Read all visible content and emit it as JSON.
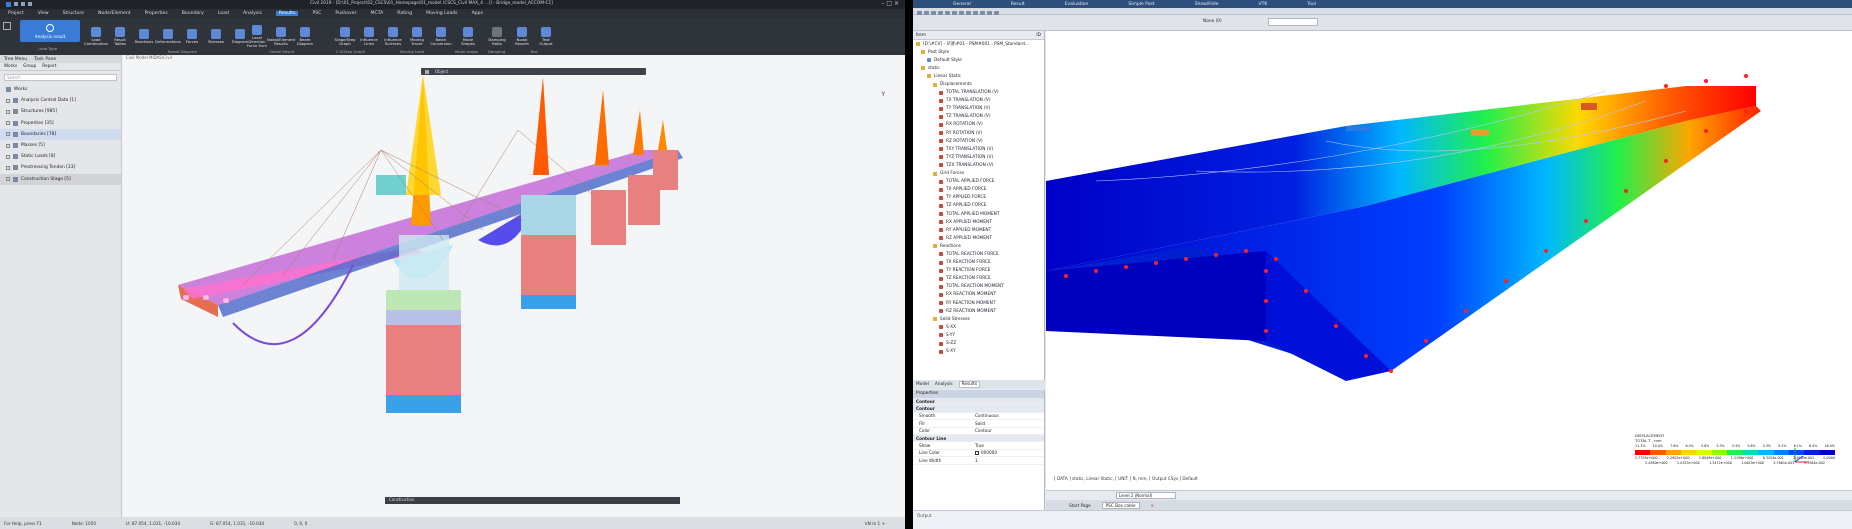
{
  "left": {
    "title": "Civil 2019 - [D:\\01_Project\\02_CSCS\\01_Homepage\\01_model (CSCS_Civil MAX_4 …)] - Bridge_model_ACCOM-C1]",
    "menu": [
      "Project",
      "View",
      "Structure",
      "Node/Element",
      "Properties",
      "Boundary",
      "Load",
      "Analysis",
      "Results",
      "PSC",
      "Pushover",
      "MCTA",
      "Rating",
      "Moving Loads",
      "Apps"
    ],
    "active_menu": "Results",
    "ribbon": {
      "analysis_result": "Analysis result",
      "load_type": "Load Type",
      "groups": [
        {
          "label": "Result Diagram",
          "buttons": [
            "Load Combination",
            "Result Tables",
            "Reactions",
            "Deformations",
            "Forces",
            "Stresses",
            "Diagram"
          ]
        },
        {
          "label": "Detail Result",
          "buttons": [
            "Local Direction Force Sum",
            "Nodal/Element Results",
            "Beam Diagram"
          ]
        },
        {
          "label": "Moving Load",
          "buttons": [
            "Stage/Step Graph",
            "Influence Lines",
            "Influence Surfaces",
            "Moving Tracer",
            "Batch Conversion"
          ]
        },
        {
          "label": "Mode shape",
          "buttons": [
            "Mode Shapes"
          ]
        },
        {
          "label": "Damping",
          "buttons": [
            "Damping Ratio"
          ]
        },
        {
          "label": "Text",
          "buttons": [
            "Nodal Results",
            "Text Output"
          ]
        }
      ],
      "c_sub": "C.S/Step Graph"
    },
    "sidebar": {
      "tabs": [
        "Tree Menu",
        "Task Pane"
      ],
      "subtabs": [
        "Works",
        "Group",
        "Report"
      ],
      "search_placeholder": "Search",
      "items": [
        {
          "label": "Works"
        },
        {
          "label": "Analysis Control Data [1]"
        },
        {
          "label": "Structures [985]"
        },
        {
          "label": "Properties [35]"
        },
        {
          "label": "Boundaries [78]"
        },
        {
          "label": "Masses [5]"
        },
        {
          "label": "Static Loads [8]"
        },
        {
          "label": "Prestressing Tendon [23]"
        },
        {
          "label": "Construction Stage [5]"
        }
      ]
    },
    "viewport_label": "Civil Model  MIDAS/Civil",
    "vp_toolbar": "Object",
    "timeline": "Construction",
    "axis_y": "Y",
    "status": [
      "For Help, press F1",
      "Node: 1050",
      "U: 87.054, 1.031, -10.034",
      "G: 87.054, 1.031, -10.034",
      "0, 0, 0"
    ],
    "status_right": "kN  m  1  +"
  },
  "right": {
    "tabs": [
      "General",
      "Result",
      "Evaluation",
      "Simple Post",
      "Show/Hide",
      "VTK",
      "Tool"
    ],
    "tree_header": "Item",
    "tree_header_right": "ID",
    "tree": [
      "[D:\\#CV] - 모델\\#01 - PSM#001 : PSM_Standard…",
      "Post Style",
      "Default Style",
      "static",
      "Linear Static",
      "Displacements",
      "TOTAL TRANSLATION (V)",
      "TX TRANSLATION (V)",
      "TY TRANSLATION (V)",
      "TZ TRANSLATION (V)",
      "RX ROTATION (V)",
      "RY ROTATION (V)",
      "RZ ROTATION (V)",
      "TXY TRANSLATION (V)",
      "TYZ TRANSLATION (V)",
      "TZX TRANSLATION (V)",
      "Grid Forces",
      "TOTAL APPLIED FORCE",
      "TX APPLIED FORCE",
      "TY APPLIED FORCE",
      "TZ APPLIED FORCE",
      "TOTAL APPLIED MOMENT",
      "RX APPLIED MOMENT",
      "RY APPLIED MOMENT",
      "RZ APPLIED MOMENT",
      "Reactions",
      "TOTAL REACTION FORCE",
      "TX REACTION FORCE",
      "TY REACTION FORCE",
      "TZ REACTION FORCE",
      "TOTAL REACTION MOMENT",
      "RX REACTION MOMENT",
      "RY REACTION MOMENT",
      "RZ REACTION MOMENT",
      "Solid Stresses",
      "S-XX",
      "S-YY",
      "S-ZZ",
      "S-XY"
    ],
    "panel_tabs": [
      "Model",
      "Analysis",
      "Results"
    ],
    "active_panel_tab": "Results",
    "props_title": "Properties",
    "props": [
      {
        "section": "Contour"
      },
      {
        "section": "Contour"
      },
      {
        "k": "Smooth",
        "v": "Continuous"
      },
      {
        "k": "Fill",
        "v": "Solid"
      },
      {
        "k": "Color",
        "v": "Contour"
      },
      {
        "section": "Contour Line"
      },
      {
        "k": "Show",
        "v": "True"
      },
      {
        "k": "Line Color",
        "v": "000000"
      },
      {
        "k": "Line Width",
        "v": "1"
      }
    ],
    "none_label": "None (0)",
    "legend": {
      "title1": "DISPLACEMENT",
      "title2": "TOTAL T , mm",
      "percents": [
        "11.3%",
        "10.0%",
        "7.6%",
        "6.5%",
        "5.6%",
        "5.3%",
        "5.3%",
        "5.6%",
        "5.3%",
        "5.2%",
        "6.1%",
        "6.4%",
        "16.0%"
      ],
      "values_top": [
        "2.7755e+000",
        "2.2902e+000",
        "1.8049e+000",
        "1.3196e+000",
        "8.3434e-001",
        "3.4909e-001",
        "0.0000"
      ],
      "values_bottom": [
        "2.4580e+000",
        "2.0325e+000",
        "1.5472e+000",
        "1.0619e+000",
        "5.7661e-001",
        "9.1364e-002"
      ],
      "colors": [
        "#ff0000",
        "#ff5a00",
        "#ffa500",
        "#ffd800",
        "#d8ff00",
        "#8cff00",
        "#22f04a",
        "#00e0b0",
        "#00b8ff",
        "#0080ff",
        "#0048ff",
        "#0020e0",
        "#0000c8"
      ]
    },
    "status": "[ DATA ] static, Linear Static,  [ UNIT ]  N, mm,  [ Output CSys ] Default",
    "bottom_input": "Level 2 (Normal)",
    "doc_tabs": [
      "Start Page",
      "PSC Box cable"
    ],
    "active_doc_tab": "PSC Box cable",
    "msg": "Output"
  }
}
